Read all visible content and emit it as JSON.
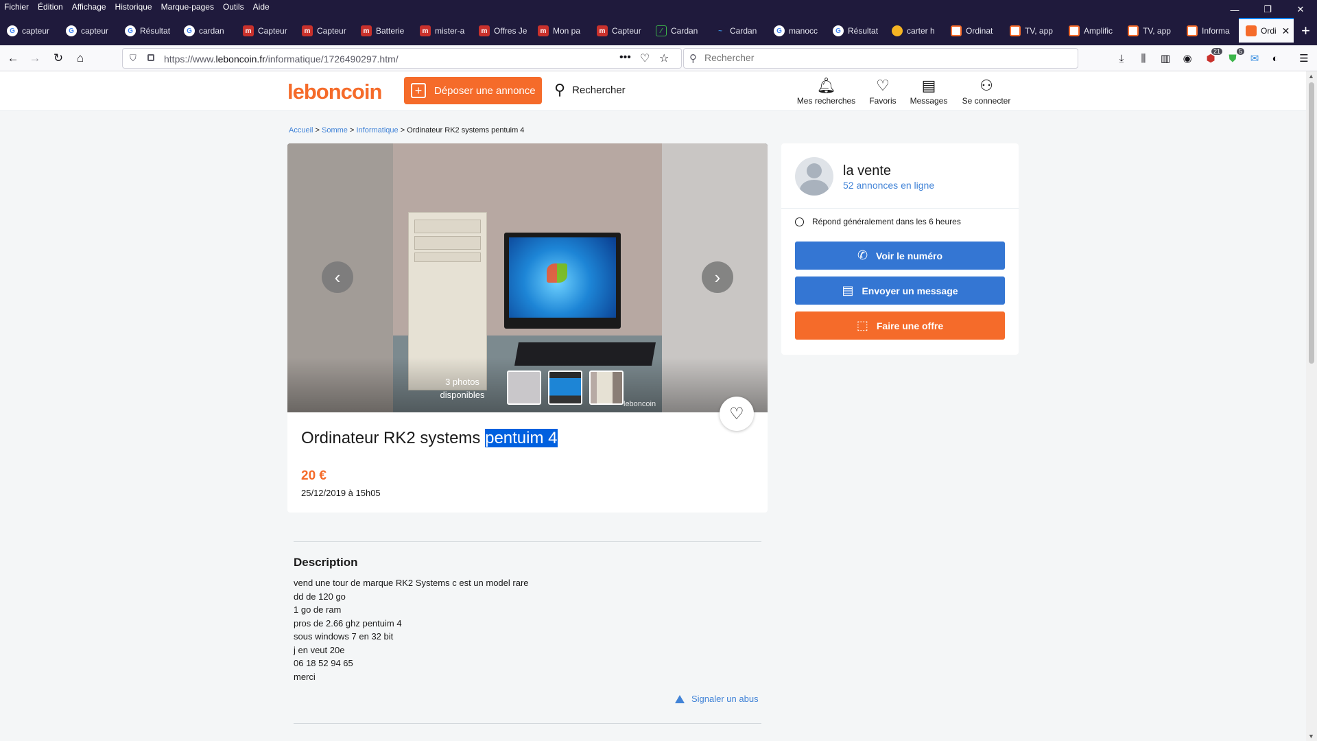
{
  "menubar": {
    "items": [
      "Fichier",
      "Édition",
      "Affichage",
      "Historique",
      "Marque-pages",
      "Outils",
      "Aide"
    ],
    "minimize": "—",
    "restore": "❐",
    "close": "✕"
  },
  "tabs": [
    {
      "label": "capteur",
      "icon": "google-icon"
    },
    {
      "label": "capteur",
      "icon": "google-icon"
    },
    {
      "label": "Résultat",
      "icon": "google-icon"
    },
    {
      "label": "cardan",
      "icon": "google-icon"
    },
    {
      "label": "Capteur",
      "icon": "mister-auto-icon"
    },
    {
      "label": "Capteur",
      "icon": "mister-auto-icon"
    },
    {
      "label": "Batterie",
      "icon": "mister-auto-icon"
    },
    {
      "label": "mister-a",
      "icon": "mister-auto-icon"
    },
    {
      "label": "Offres Je",
      "icon": "mister-auto-icon"
    },
    {
      "label": "Mon pa",
      "icon": "mister-auto-icon"
    },
    {
      "label": "Capteur",
      "icon": "mister-auto-icon"
    },
    {
      "label": "Cardan",
      "icon": "green-site-icon"
    },
    {
      "label": "Cardan",
      "icon": "blue-site-icon"
    },
    {
      "label": "manocc",
      "icon": "google-icon"
    },
    {
      "label": "Résultat",
      "icon": "google-icon"
    },
    {
      "label": "carter h",
      "icon": "carter-icon"
    },
    {
      "label": "Ordinat",
      "icon": "leboncoin-icon"
    },
    {
      "label": "TV, app",
      "icon": "leboncoin-icon"
    },
    {
      "label": "Amplific",
      "icon": "leboncoin-icon"
    },
    {
      "label": "TV, app",
      "icon": "leboncoin-icon"
    },
    {
      "label": "Informa",
      "icon": "leboncoin-icon"
    },
    {
      "label": "Ordi",
      "icon": "leboncoin-icon",
      "active": true
    }
  ],
  "urlbar": {
    "url_prefix": "https://www.",
    "url_domain": "leboncoin.fr",
    "url_path": "/informatique/1726490297.htm/"
  },
  "search": {
    "placeholder": "Rechercher"
  },
  "toolbar_badges": {
    "ublock": "21",
    "shield": "5"
  },
  "site": {
    "logo": "leboncoin",
    "deposer": "Déposer une annonce",
    "rechercher": "Rechercher",
    "nav": {
      "recherches": "Mes recherches",
      "favoris": "Favoris",
      "messages": "Messages",
      "connecter": "Se connecter"
    }
  },
  "breadcrumb": {
    "accueil": "Accueil",
    "somme": "Somme",
    "informatique": "Informatique",
    "current": "Ordinateur RK2 systems pentuim 4"
  },
  "gallery": {
    "count_line1": "3 photos",
    "count_line2": "disponibles",
    "watermark": "leboncoin"
  },
  "ad": {
    "title_main": "Ordinateur RK2 systems ",
    "title_selected": "pentuim 4",
    "price": "20 €",
    "date": "25/12/2019 à 15h05"
  },
  "description": {
    "title": "Description",
    "body": "vend une tour de marque RK2 Systems c est un model rare\ndd de 120 go\n1 go de ram\npros de 2.66 ghz pentuim 4\nsous windows 7 en 32 bit\nj en veut 20e\n06 18 52 94 65\nmerci",
    "report": "Signaler un abus"
  },
  "seller": {
    "name": "la vente",
    "ads": "52 annonces en ligne",
    "reply": "Répond généralement dans les 6 heures",
    "phone_btn": "Voir le numéro",
    "message_btn": "Envoyer un message",
    "offer_btn": "Faire une offre"
  },
  "colors": {
    "brand": "#f56b2a",
    "blue": "#3476d3",
    "link": "#4183d7",
    "chrome": "#1f1a3c"
  }
}
